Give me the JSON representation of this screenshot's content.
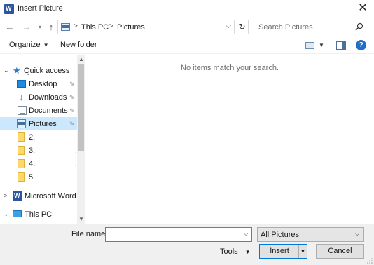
{
  "window": {
    "title": "Insert Picture",
    "close_glyph": "✕"
  },
  "nav": {
    "back_glyph": "←",
    "forward_glyph": "→",
    "recent_glyph": "▾",
    "up_glyph": "↑",
    "breadcrumb": [
      "This PC",
      "Pictures"
    ],
    "separator": ">",
    "address_dropdown_glyph": "⌵",
    "refresh_glyph": "↻"
  },
  "search": {
    "placeholder": "Search Pictures"
  },
  "toolbar": {
    "organize_label": "Organize",
    "organize_caret": "▼",
    "new_folder_label": "New folder",
    "view_caret": "▼",
    "help_glyph": "?"
  },
  "sidebar": {
    "items": [
      {
        "label": "Quick access",
        "chevron": "⌄",
        "icon": "star-icon"
      },
      {
        "label": "Desktop",
        "pin": "📌",
        "icon": "desktop-icon"
      },
      {
        "label": "Downloads",
        "pin": "📌",
        "icon": "download-icon"
      },
      {
        "label": "Documents",
        "pin": "📌",
        "icon": "documents-icon"
      },
      {
        "label": "Pictures",
        "pin": "📌",
        "icon": "pictures-icon",
        "selected": true
      },
      {
        "label": "2.",
        "icon": "folder-icon"
      },
      {
        "label": "3.",
        "icon": "folder-icon",
        "trail": "."
      },
      {
        "label": "4.",
        "icon": "folder-icon",
        "trail": ":"
      },
      {
        "label": "5.",
        "icon": "folder-icon",
        "trail": "."
      },
      {
        "label": "Microsoft Word",
        "chevron": ">",
        "icon": "word-icon"
      },
      {
        "label": "This PC",
        "chevron": "⌄",
        "icon": "pc-icon"
      }
    ],
    "scroll_up_glyph": "▲",
    "scroll_down_glyph": "▼"
  },
  "content": {
    "empty_message": "No items match your search."
  },
  "footer": {
    "file_name_label": "File name:",
    "file_name_value": "",
    "file_name_caret": "⌵",
    "file_type_selected": "All Pictures",
    "file_type_caret": "⌵",
    "tools_label": "Tools",
    "tools_caret": "▼",
    "insert_label": "Insert",
    "insert_split_glyph": "▼",
    "cancel_label": "Cancel"
  },
  "colors": {
    "selection": "#cce8ff",
    "accent": "#0078d7",
    "help": "#1f6fc5",
    "folder": "#ffd86b"
  }
}
